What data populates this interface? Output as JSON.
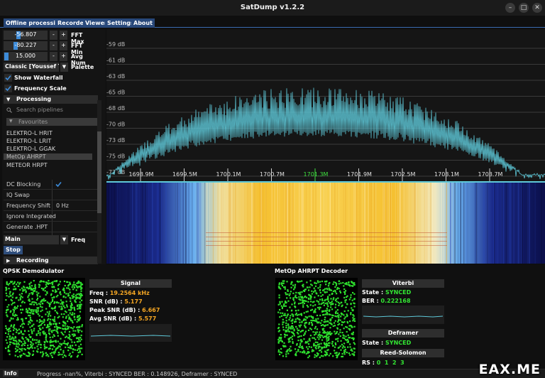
{
  "window": {
    "title": "SatDump v1.2.2",
    "minimize": "–",
    "maximize": "□",
    "close": "✕"
  },
  "tabs": [
    "Offline processing",
    "Recorder",
    "Viewer",
    "Settings",
    "About"
  ],
  "controls": {
    "fft_max": {
      "value": "-56.807",
      "label": "FFT Max"
    },
    "fft_min": {
      "value": "-80.227",
      "label": "FFT Min"
    },
    "avg_num": {
      "value": "15.000",
      "label": "Avg Num"
    },
    "palette": {
      "value": "Classic [Youssef Tou",
      "label": "Palette"
    },
    "minus": "-",
    "plus": "+",
    "show_waterfall": "Show Waterfall",
    "frequency_scale": "Frequency Scale"
  },
  "processing": {
    "header": "Processing",
    "search_placeholder": "Search pipelines",
    "favourites": "Favourites",
    "pipelines": [
      "ELEKTRO-L HRIT",
      "ELEKTRO-L LRIT",
      "ELEKTRO-L GGAK",
      "MetOp AHRPT",
      "METEOR HRPT"
    ],
    "options": [
      {
        "key": "DC Blocking",
        "value": ""
      },
      {
        "key": "IQ Swap",
        "value": ""
      },
      {
        "key": "Frequency Shift",
        "value": "0 Hz"
      },
      {
        "key": "Ignore Integrated",
        "value": ""
      },
      {
        "key": "Generate .HPT",
        "value": ""
      }
    ],
    "source": "Main",
    "freq_label": "Freq",
    "stop": "Stop",
    "recording": "Recording"
  },
  "spectrum": {
    "db_labels": [
      "-59 dB",
      "-61 dB",
      "-63 dB",
      "-65 dB",
      "-68 dB",
      "-70 dB",
      "-73 dB",
      "-75 dB",
      "-77 dB"
    ],
    "freq_labels": [
      "1698.9M",
      "1699.5M",
      "1700.1M",
      "1700.7M",
      "1701.3M",
      "1701.9M",
      "1702.5M",
      "1703.1M",
      "1703.7M"
    ],
    "center_freq": "1701.3M",
    "trace_color": "#5ec8d8"
  },
  "qpsk": {
    "title": "QPSK Demodulator",
    "signal_header": "Signal",
    "freq_label": "Freq :",
    "freq_value": "19.2564 kHz",
    "snr_label": "SNR (dB) :",
    "snr_value": "5.177",
    "peak_label": "Peak SNR (dB) :",
    "peak_value": "6.667",
    "avg_label": "Avg SNR (dB) :",
    "avg_value": "5.577"
  },
  "decoder": {
    "title": "MetOp AHRPT Decoder",
    "viterbi_header": "Viterbi",
    "state_label": "State :",
    "viterbi_state": "SYNCED",
    "ber_label": "BER :",
    "ber_value": "0.222168",
    "deframer_header": "Deframer",
    "deframer_state": "SYNCED",
    "rs_header": "Reed-Solomon",
    "rs_label": "RS :",
    "rs_values": "0  1  2  3"
  },
  "status": {
    "info": "Info",
    "message": "Progress -nan%, Viterbi : SYNCED BER : 0.148926, Deframer : SYNCED"
  },
  "watermark": "EAX.ME",
  "colors": {
    "accent": "#3d8bd8",
    "tab": "#28487a",
    "constellation": "#2ee02e",
    "value": "#f5a623",
    "synced": "#33e633"
  }
}
